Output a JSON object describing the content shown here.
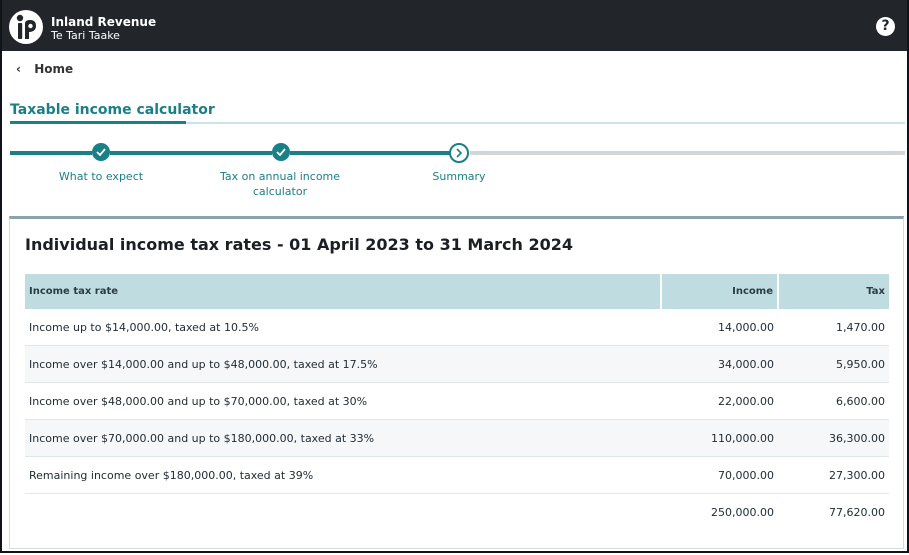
{
  "header": {
    "brand_name": "Inland Revenue",
    "brand_sub": "Te Tari Taake",
    "help_label": "?"
  },
  "breadcrumb": {
    "home_label": "Home"
  },
  "page": {
    "title": "Taxable income calculator"
  },
  "stepper": {
    "steps": [
      {
        "label": "What to expect",
        "status": "done"
      },
      {
        "label": "Tax on annual income\ncalculator",
        "status": "done"
      },
      {
        "label": "Summary",
        "status": "current"
      }
    ]
  },
  "card": {
    "heading": "Individual income tax rates - 01 April 2023 to 31 March 2024",
    "table": {
      "headers": [
        "Income tax rate",
        "Income",
        "Tax"
      ],
      "rows": [
        [
          "Income up to $14,000.00, taxed at 10.5%",
          "14,000.00",
          "1,470.00"
        ],
        [
          "Income over $14,000.00 and up to $48,000.00, taxed at 17.5%",
          "34,000.00",
          "5,950.00"
        ],
        [
          "Income over $48,000.00 and up to $70,000.00, taxed at 30%",
          "22,000.00",
          "6,600.00"
        ],
        [
          "Income over $70,000.00 and up to $180,000.00, taxed at 33%",
          "110,000.00",
          "36,300.00"
        ],
        [
          "Remaining income over $180,000.00, taxed at 39%",
          "70,000.00",
          "27,300.00"
        ]
      ],
      "total": [
        "",
        "250,000.00",
        "77,620.00"
      ]
    }
  },
  "colors": {
    "accent": "#1a7f86",
    "header_bg": "#22262b",
    "table_header_bg": "#bfdde0"
  }
}
